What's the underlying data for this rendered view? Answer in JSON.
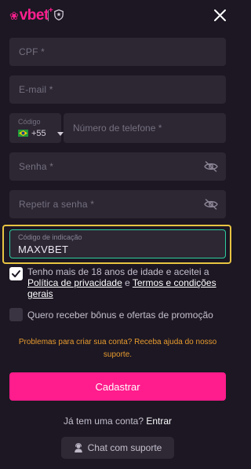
{
  "header": {
    "logo_text": "vbet",
    "logo_plus": "+"
  },
  "form": {
    "cpf_placeholder": "CPF *",
    "email_placeholder": "E-mail *",
    "country_code_label": "Código",
    "country_code_value": "+55",
    "phone_placeholder": "Número de telefone *",
    "password_placeholder": "Senha *",
    "repeat_password_placeholder": "Repetir a senha *",
    "referral_label": "Código de indicação",
    "referral_value": "MAXVBET"
  },
  "consent": {
    "terms_checked": true,
    "terms_prefix": "Tenho mais de 18 anos de idade e aceitei a ",
    "privacy_link": "Política de privacidade",
    "terms_and": " e ",
    "terms_link": "Termos e condições gerais",
    "promo_checked": false,
    "promo_label": "Quero receber bônus e ofertas de promoção"
  },
  "support": {
    "problems_text": "Problemas para criar sua conta? Receba ajuda do nosso suporte.",
    "chat_label": "Chat com suporte"
  },
  "actions": {
    "submit_label": "Cadastrar",
    "login_prompt": "Já tem uma conta?",
    "login_link": "Entrar"
  },
  "colors": {
    "brand_pink": "#ff1c8c",
    "background": "#1c1723",
    "field_bg": "#2c2733",
    "active_border": "#2ecf9f",
    "warning": "#e89b2e",
    "highlight": "#e8c442"
  },
  "icons": [
    "logo-rabbit-icon",
    "shield-icon",
    "close-icon",
    "brazil-flag-icon",
    "eye-off-icon",
    "check-icon",
    "support-agent-icon"
  ]
}
